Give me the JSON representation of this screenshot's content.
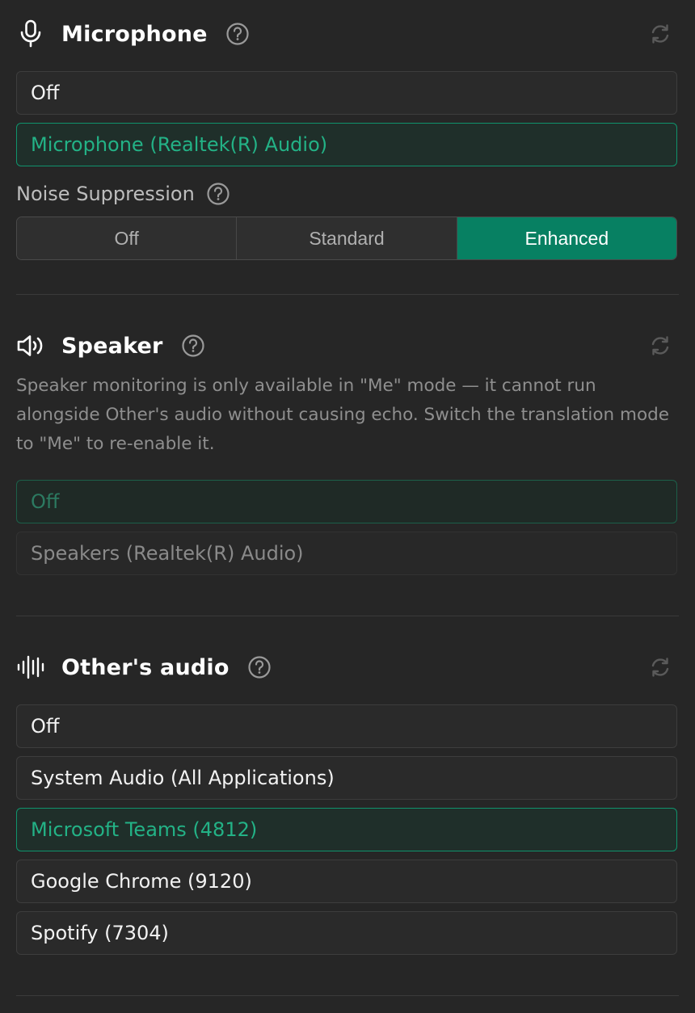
{
  "microphone": {
    "title": "Microphone",
    "icon": "microphone-icon",
    "options": [
      {
        "label": "Off",
        "selected": false
      },
      {
        "label": "Microphone (Realtek(R) Audio)",
        "selected": true
      }
    ],
    "noise_suppression": {
      "label": "Noise Suppression",
      "segments": [
        "Off",
        "Standard",
        "Enhanced"
      ],
      "active": "Enhanced"
    }
  },
  "speaker": {
    "title": "Speaker",
    "icon": "speaker-icon",
    "note": "Speaker monitoring is only available in \"Me\" mode — it cannot run alongside Other's audio without causing echo. Switch the translation mode to \"Me\" to re-enable it.",
    "options": [
      {
        "label": "Off",
        "selected": true
      },
      {
        "label": "Speakers (Realtek(R) Audio)",
        "selected": false
      }
    ]
  },
  "others_audio": {
    "title": "Other's audio",
    "icon": "waveform-icon",
    "options": [
      {
        "label": "Off",
        "selected": false
      },
      {
        "label": "System Audio (All Applications)",
        "selected": false
      },
      {
        "label": "Microsoft Teams (4812)",
        "selected": true
      },
      {
        "label": "Google Chrome (9120)",
        "selected": false
      },
      {
        "label": "Spotify (7304)",
        "selected": false
      }
    ]
  },
  "colors": {
    "accent": "#078062",
    "accent_text": "#23b286",
    "background": "#262626"
  }
}
